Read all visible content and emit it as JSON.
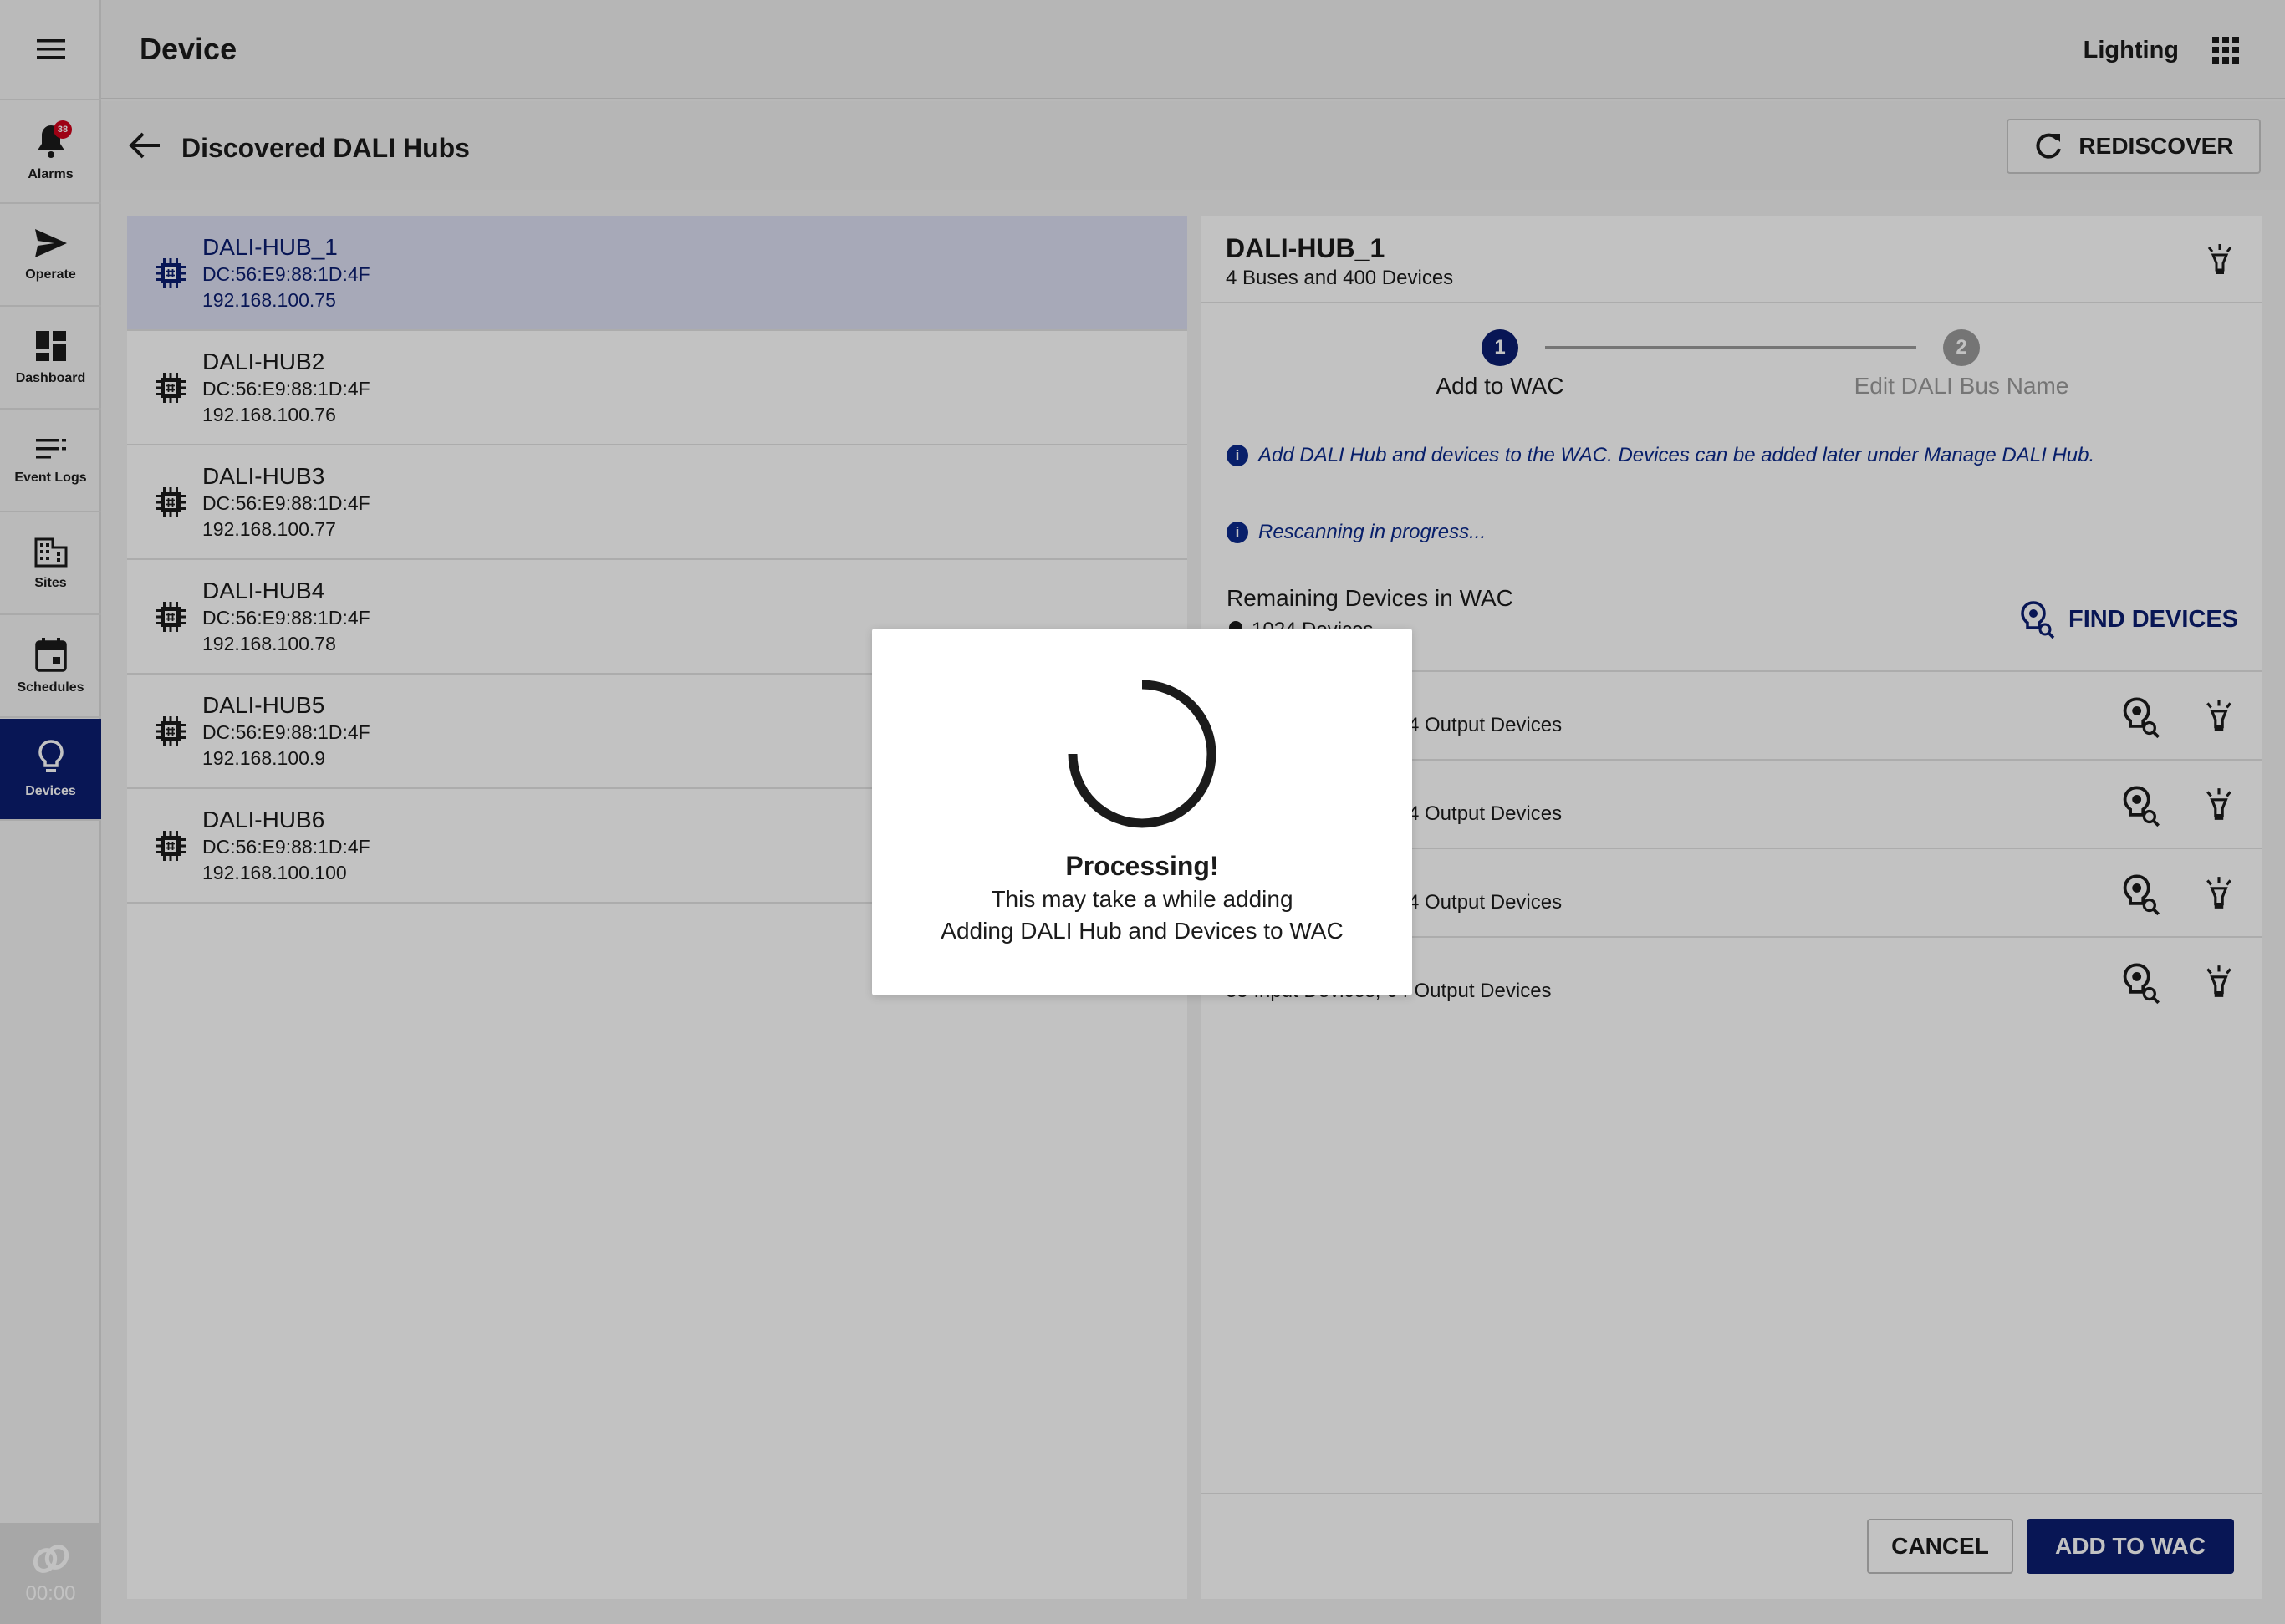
{
  "sidebar": {
    "alarms_label": "Alarms",
    "alarms_badge": "38",
    "operate_label": "Operate",
    "dashboard_label": "Dashboard",
    "event_logs_label": "Event Logs",
    "sites_label": "Sites",
    "schedules_label": "Schedules",
    "devices_label": "Devices",
    "timer": "00:00"
  },
  "topbar": {
    "title": "Device",
    "app_name": "Lighting"
  },
  "subheader": {
    "title": "Discovered DALI Hubs",
    "rediscover_label": "REDISCOVER"
  },
  "hubs": [
    {
      "name": "DALI-HUB_1",
      "mac": "DC:56:E9:88:1D:4F",
      "ip": "192.168.100.75"
    },
    {
      "name": "DALI-HUB2",
      "mac": "DC:56:E9:88:1D:4F",
      "ip": "192.168.100.76"
    },
    {
      "name": "DALI-HUB3",
      "mac": "DC:56:E9:88:1D:4F",
      "ip": "192.168.100.77"
    },
    {
      "name": "DALI-HUB4",
      "mac": "DC:56:E9:88:1D:4F",
      "ip": "192.168.100.78"
    },
    {
      "name": "DALI-HUB5",
      "mac": "DC:56:E9:88:1D:4F",
      "ip": "192.168.100.9"
    },
    {
      "name": "DALI-HUB6",
      "mac": "DC:56:E9:88:1D:4F",
      "ip": "192.168.100.100"
    }
  ],
  "detail": {
    "hub_name": "DALI-HUB_1",
    "summary": "4 Buses and 400 Devices",
    "steps": [
      {
        "number": "1",
        "label": "Add to WAC"
      },
      {
        "number": "2",
        "label": "Edit DALI Bus Name"
      }
    ],
    "info_message": "Add DALI Hub and devices to the WAC. Devices can be added later under Manage DALI Hub.",
    "rescan_message": "Rescanning in progress...",
    "remaining_label": "Remaining Devices in WAC",
    "remaining_count": "1024 Devices",
    "find_devices_label": "FIND DEVICES",
    "buses": [
      {
        "summary": "4 Output Devices"
      },
      {
        "summary": "4 Output Devices"
      },
      {
        "summary": "4 Output Devices"
      },
      {
        "summary": "35 Input Devices, 64 Output Devices"
      }
    ],
    "cancel_label": "CANCEL",
    "add_label": "ADD TO WAC"
  },
  "modal": {
    "title": "Processing!",
    "line1": "This may take a while adding",
    "line2": "Adding DALI Hub and Devices to WAC"
  },
  "colors": {
    "primary": "#0b1e70",
    "info": "#0b2a8c",
    "badge": "#d0021b",
    "step_inactive": "#9a9a9a"
  }
}
